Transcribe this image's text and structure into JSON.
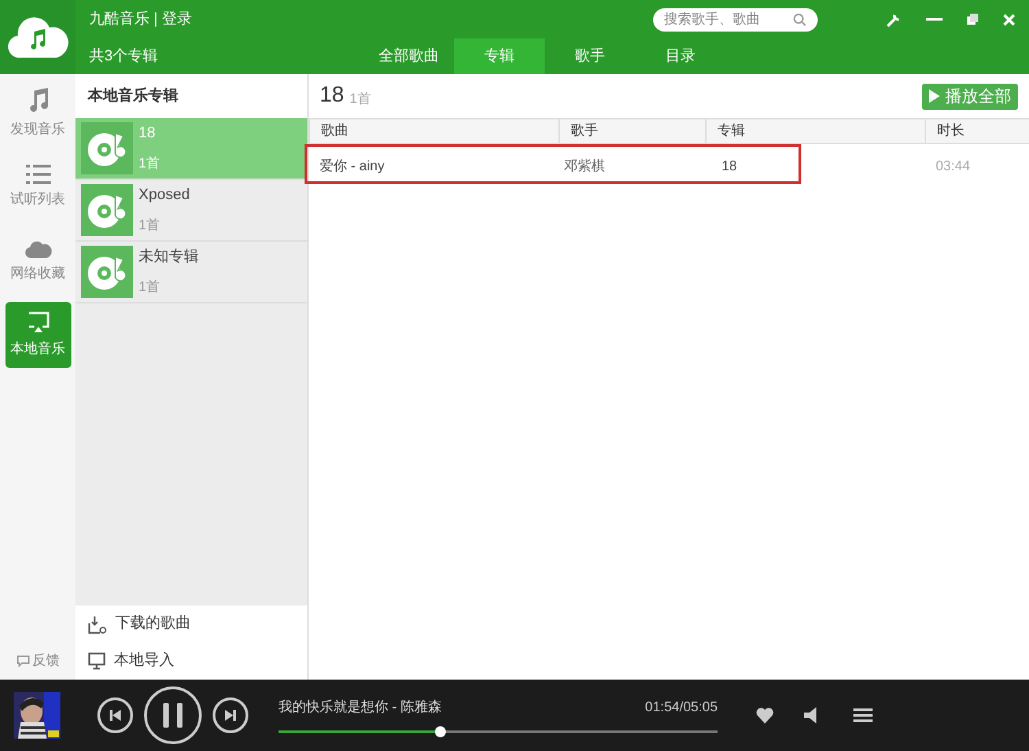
{
  "app": {
    "title": "九酷音乐 | 登录",
    "search": {
      "placeholder": "搜索歌手、歌曲"
    }
  },
  "subheader": {
    "count": "共3个专辑",
    "tabs": [
      {
        "label": "全部歌曲",
        "selected": false
      },
      {
        "label": "专辑",
        "selected": true
      },
      {
        "label": "歌手",
        "selected": false
      },
      {
        "label": "目录",
        "selected": false
      }
    ]
  },
  "nav": {
    "items": [
      {
        "kind": "music",
        "label": "发现音乐",
        "selected": false
      },
      {
        "kind": "list",
        "label": "试听列表",
        "selected": false
      },
      {
        "kind": "cloud",
        "label": "网络收藏",
        "selected": false
      },
      {
        "kind": "screen",
        "label": "本地音乐",
        "selected": true
      }
    ],
    "feedback": "反馈"
  },
  "albums": {
    "title": "本地音乐专辑",
    "items": [
      {
        "name": "18",
        "count": "1首",
        "selected": true
      },
      {
        "name": "Xposed",
        "count": "1首",
        "selected": false
      },
      {
        "name": "未知专辑",
        "count": "1首",
        "selected": false
      }
    ],
    "links": [
      {
        "kind": "download",
        "label": "下载的歌曲"
      },
      {
        "kind": "monitor",
        "label": "本地导入"
      }
    ]
  },
  "main": {
    "title": "18",
    "count": "1首",
    "play_all": "播放全部",
    "columns": [
      "歌曲",
      "歌手",
      "专辑",
      "时长"
    ],
    "rows": [
      {
        "song": "爱你 - ainy",
        "artist": "邓紫棋",
        "album": "18",
        "duration": "03:44",
        "highlighted": true
      }
    ]
  },
  "player": {
    "track": "我的快乐就是想你 - 陈雅森",
    "time": "01:54/05:05",
    "level": 0.37
  }
}
